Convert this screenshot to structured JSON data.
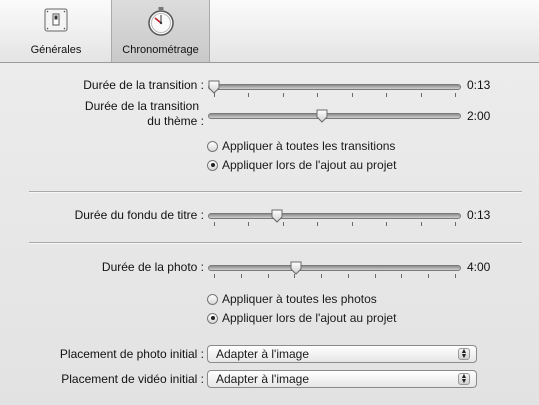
{
  "toolbar": {
    "tabs": [
      {
        "label": "Générales",
        "icon": "switch-icon"
      },
      {
        "label": "Chronométrage",
        "icon": "stopwatch-icon"
      }
    ]
  },
  "settings": {
    "transition": {
      "label": "Durée de la transition :",
      "value": "0:13",
      "level": 0.0
    },
    "theme_transition": {
      "label_line1": "Durée de la transition",
      "label_line2": "du thème :",
      "value": "2:00",
      "level": 0.45
    },
    "transition_apply": {
      "option1": "Appliquer à toutes les transitions",
      "option2": "Appliquer lors de l'ajout au projet",
      "selected": 1
    },
    "title_fade": {
      "label": "Durée du fondu de titre :",
      "value": "0:13",
      "level": 0.26
    },
    "photo": {
      "label": "Durée de la photo :",
      "value": "4:00",
      "level": 0.34
    },
    "photo_apply": {
      "option1": "Appliquer à toutes les photos",
      "option2": "Appliquer lors de l'ajout au projet",
      "selected": 1
    },
    "initial_photo": {
      "label": "Placement de photo initial :",
      "value": "Adapter à l'image"
    },
    "initial_video": {
      "label": "Placement de vidéo initial :",
      "value": "Adapter à l'image"
    }
  }
}
